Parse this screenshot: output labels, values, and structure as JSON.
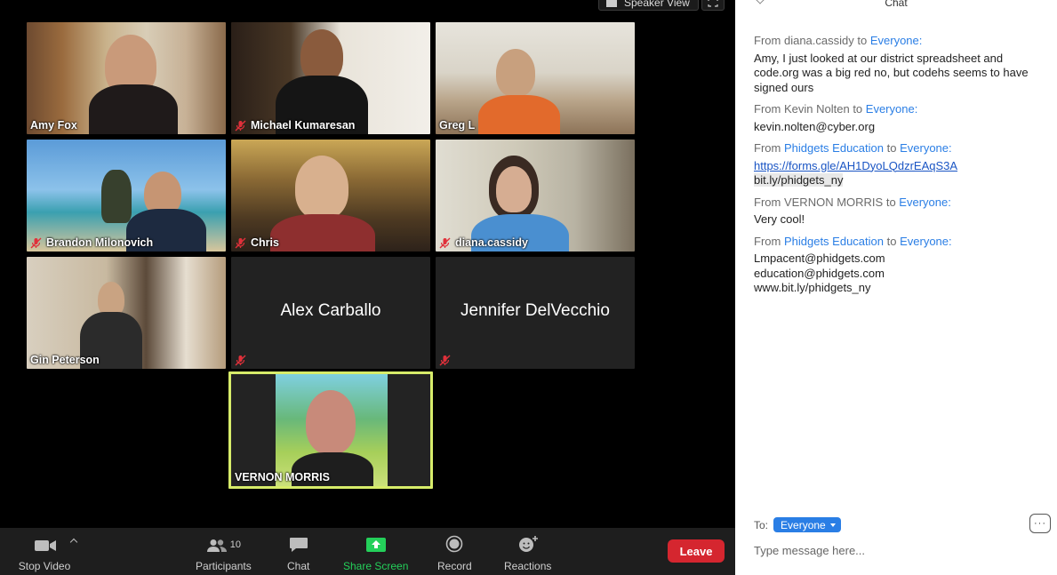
{
  "top_bar": {
    "speaker_view_label": "Speaker View"
  },
  "tiles": [
    {
      "name": "Amy Fox",
      "muted": false
    },
    {
      "name": "Michael Kumaresan",
      "muted": true
    },
    {
      "name": "Greg L",
      "muted": false
    },
    {
      "name": "Brandon Milonovich",
      "muted": true
    },
    {
      "name": "Chris",
      "muted": true
    },
    {
      "name": "diana.cassidy",
      "muted": true
    },
    {
      "name": "Gin Peterson",
      "muted": false
    },
    {
      "name": "Alex Carballo",
      "muted": true
    },
    {
      "name": "Jennifer DelVecchio",
      "muted": true
    },
    {
      "name": "VERNON MORRIS",
      "muted": false,
      "active_speaker": true
    }
  ],
  "toolbar": {
    "stop_video": "Stop Video",
    "participants": "Participants",
    "participants_count": "10",
    "chat": "Chat",
    "share_screen": "Share Screen",
    "record": "Record",
    "reactions": "Reactions",
    "leave": "Leave"
  },
  "chat": {
    "title": "Chat",
    "messages": [
      {
        "from_prefix": "From",
        "sender": "diana.cassidy",
        "to_word": "to",
        "recipient": "Everyone:",
        "lines": [
          "Amy, I just looked at our district spreadsheet and code.org was a big red no, but codehs seems to have signed ours"
        ]
      },
      {
        "from_prefix": "From",
        "sender": "Kevin Nolten",
        "to_word": "to",
        "recipient": "Everyone:",
        "lines": [
          "kevin.nolten@cyber.org"
        ]
      },
      {
        "from_prefix": "From",
        "sender": "Phidgets Education",
        "to_word": "to",
        "recipient": "Everyone:",
        "lines": [
          "https://forms.gle/AH1DyoLQdzrEAqS3A",
          "bit.ly/phidgets_ny"
        ]
      },
      {
        "from_prefix": "From",
        "sender": "VERNON MORRIS",
        "to_word": "to",
        "recipient": "Everyone:",
        "lines": [
          "Very cool!"
        ]
      },
      {
        "from_prefix": "From",
        "sender": "Phidgets Education",
        "to_word": "to",
        "recipient": "Everyone:",
        "lines": [
          "Lmpacent@phidgets.com",
          "education@phidgets.com",
          "www.bit.ly/phidgets_ny"
        ]
      }
    ],
    "to_label": "To:",
    "to_value": "Everyone",
    "more_label": "···",
    "input_placeholder": "Type message here..."
  },
  "colors": {
    "accent_blue": "#2a7ee5",
    "share_green": "#24d05a",
    "leave_red": "#d5262f",
    "active_speaker_border": "#d7ec6a"
  }
}
